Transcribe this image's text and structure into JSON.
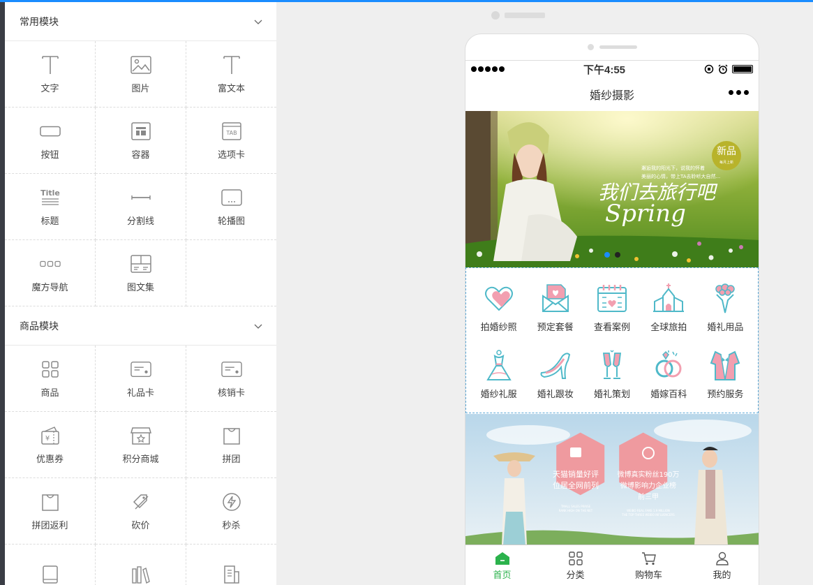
{
  "left_panel": {
    "sections": [
      {
        "title": "常用模块",
        "items": [
          {
            "label": "文字",
            "icon": "text-icon"
          },
          {
            "label": "图片",
            "icon": "image-icon"
          },
          {
            "label": "富文本",
            "icon": "rich-text-icon"
          },
          {
            "label": "按钮",
            "icon": "button-icon"
          },
          {
            "label": "容器",
            "icon": "container-icon"
          },
          {
            "label": "选项卡",
            "icon": "tab-icon"
          },
          {
            "label": "标题",
            "icon": "title-icon"
          },
          {
            "label": "分割线",
            "icon": "divider-icon"
          },
          {
            "label": "轮播图",
            "icon": "carousel-icon"
          },
          {
            "label": "魔方导航",
            "icon": "cube-nav-icon"
          },
          {
            "label": "图文集",
            "icon": "image-text-icon"
          }
        ]
      },
      {
        "title": "商品模块",
        "items": [
          {
            "label": "商品",
            "icon": "product-icon"
          },
          {
            "label": "礼品卡",
            "icon": "gift-card-icon"
          },
          {
            "label": "核销卡",
            "icon": "verify-card-icon"
          },
          {
            "label": "优惠券",
            "icon": "coupon-icon"
          },
          {
            "label": "积分商城",
            "icon": "points-mall-icon"
          },
          {
            "label": "拼团",
            "icon": "group-buy-icon"
          },
          {
            "label": "拼团返利",
            "icon": "group-rebate-icon"
          },
          {
            "label": "砍价",
            "icon": "bargain-icon"
          },
          {
            "label": "秒杀",
            "icon": "flash-sale-icon"
          }
        ]
      }
    ],
    "tab_icon_text": "TAB",
    "title_icon_text": "Title"
  },
  "phone": {
    "status": {
      "time": "下午4:55"
    },
    "nav_title": "婚纱摄影",
    "banner": {
      "badge": "新品",
      "badge_sub": "每月上新",
      "line1": "邂逅我的阳光下，说我的怀着",
      "line2": "美丽的心情，带上TA去聆听大自然...",
      "heading": "我们去旅行吧",
      "script": "Spring"
    },
    "entries": [
      {
        "label": "拍婚纱照",
        "icon": "heart-icon"
      },
      {
        "label": "预定套餐",
        "icon": "envelope-heart-icon"
      },
      {
        "label": "查看案例",
        "icon": "calendar-heart-icon"
      },
      {
        "label": "全球旅拍",
        "icon": "church-icon"
      },
      {
        "label": "婚礼用品",
        "icon": "bouquet-icon"
      },
      {
        "label": "婚纱礼服",
        "icon": "wedding-dress-icon"
      },
      {
        "label": "婚礼跟妆",
        "icon": "high-heel-icon"
      },
      {
        "label": "婚礼策划",
        "icon": "champagne-icon"
      },
      {
        "label": "婚嫁百科",
        "icon": "rings-icon"
      },
      {
        "label": "预约服务",
        "icon": "tuxedo-icon"
      }
    ],
    "promo": {
      "left_text1": "天猫销量好评",
      "left_text2": "位居全网前列",
      "left_small1": "TMALL SALES PRAISE",
      "left_small2": "RANK HIGH ON THE NET",
      "right_text1": "微博真实粉丝190万",
      "right_text2": "微博影响力企业榜",
      "right_text3": "前三甲",
      "right_small1": "WEIBO REAL FANS 1.9 MILLION",
      "right_small2": "THE TOP THREE WEIBO INFLUENCERS"
    },
    "tabs": [
      {
        "label": "首页",
        "icon": "home-icon",
        "active": true
      },
      {
        "label": "分类",
        "icon": "category-icon",
        "active": false
      },
      {
        "label": "购物车",
        "icon": "cart-icon",
        "active": false
      },
      {
        "label": "我的",
        "icon": "user-icon",
        "active": false
      }
    ]
  },
  "colors": {
    "accent": "#2bb24c",
    "entry_teal": "#4fb9c9",
    "entry_pink": "#f29fb0",
    "promo_pink": "#ef9a9f"
  }
}
